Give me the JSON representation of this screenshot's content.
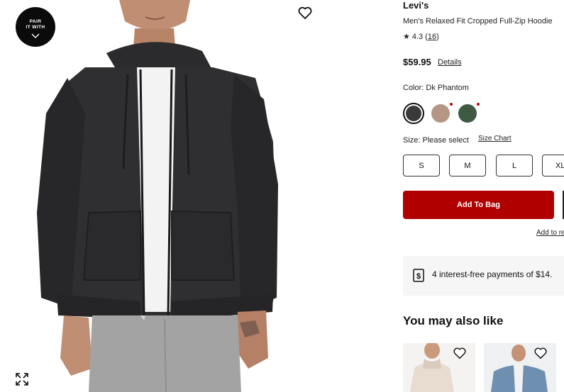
{
  "badge": {
    "line1": "PAIR",
    "line2": "IT WITH"
  },
  "product": {
    "brand": "Levi's",
    "name": "Men's Relaxed Fit Cropped Full-Zip Hoodie",
    "rating": "4.3",
    "review_count": "16",
    "price": "$59.95",
    "details_label": "Details"
  },
  "color": {
    "label": "Color: Dk Phantom",
    "swatches": [
      {
        "name": "Dk Phantom",
        "hex": "#3a3a3c"
      },
      {
        "name": "tan",
        "hex": "#b39684"
      },
      {
        "name": "green",
        "hex": "#3f5a42"
      }
    ]
  },
  "size": {
    "label": "Size: Please select",
    "chart_label": "Size Chart",
    "options": [
      "S",
      "M",
      "L",
      "XL"
    ]
  },
  "actions": {
    "add_to_bag": "Add To Bag",
    "add_to_registry": "Add to re"
  },
  "payment": {
    "text": "4 interest-free payments of $14."
  },
  "recommendations": {
    "heading": "You may also like"
  },
  "icons": {
    "favorite": "heart-outline-icon",
    "expand": "expand-icon",
    "chevron": "chevron-down-icon",
    "payment": "dollar-card-icon",
    "star": "star-icon"
  },
  "colors": {
    "add_to_bag_bg": "#b00000",
    "notice_dot": "#c30000"
  }
}
